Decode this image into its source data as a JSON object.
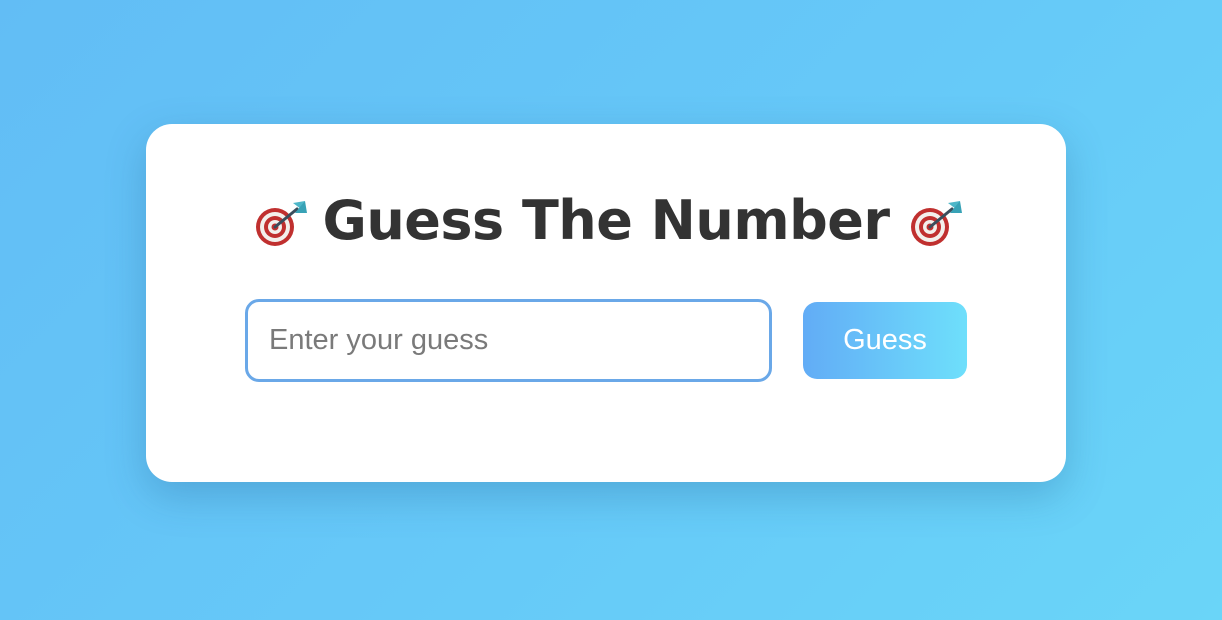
{
  "game": {
    "title": "Guess The Number",
    "title_icon": "dart-target-icon",
    "input_placeholder": "Enter your guess",
    "input_value": "",
    "button_label": "Guess"
  },
  "colors": {
    "background_start": "#62bdf5",
    "background_end": "#6ad5f8",
    "card": "#ffffff",
    "title_text": "#333333",
    "input_border": "#6aa8e8",
    "button_gradient_start": "#62acf6",
    "button_gradient_end": "#6edffb",
    "button_text": "#ffffff"
  }
}
